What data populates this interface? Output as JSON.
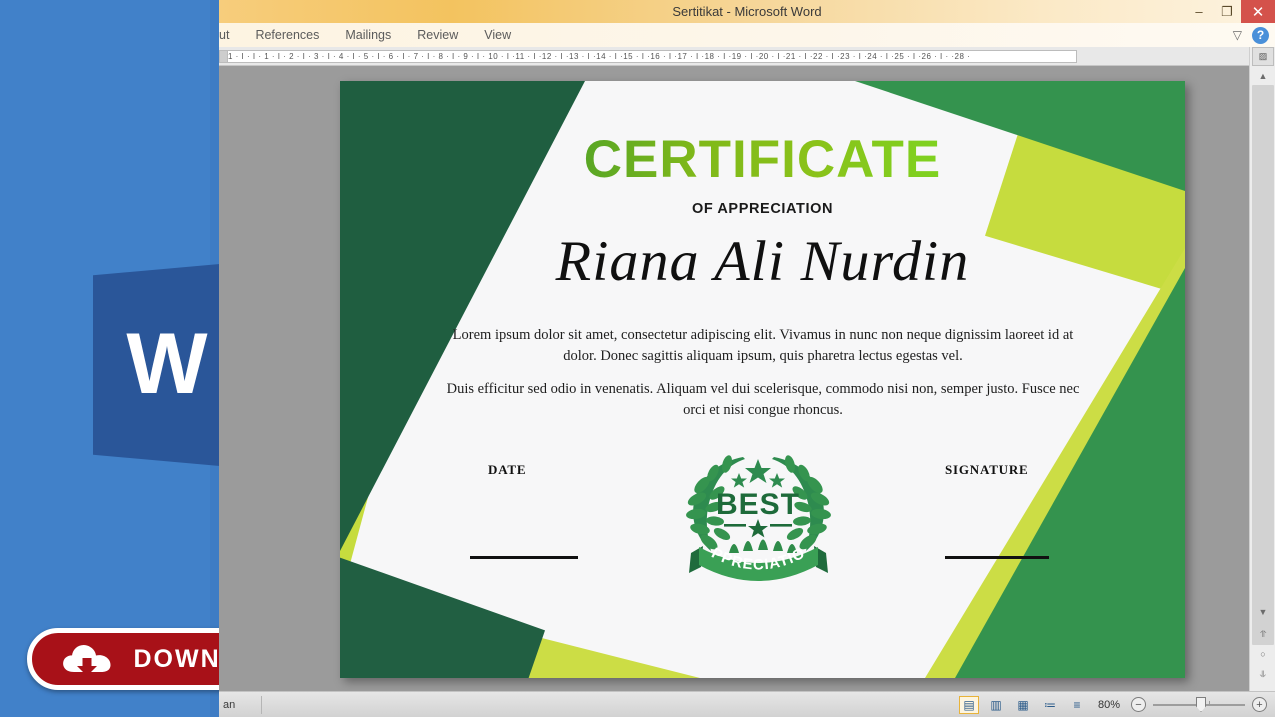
{
  "window": {
    "title": "Sertitikat  -  Microsoft Word",
    "minimize_label": "–",
    "restore_label": "❐",
    "close_label": "✕",
    "collapse_ribbon_label": "▽",
    "help_label": "?"
  },
  "ribbon": {
    "tabs": [
      {
        "label": "ut"
      },
      {
        "label": "References"
      },
      {
        "label": "Mailings"
      },
      {
        "label": "Review"
      },
      {
        "label": "View"
      }
    ]
  },
  "ruler": {
    "marks": "1  ·  I  ·  I  ·  1  ·  I  ·  2  ·  I  ·  3  ·  I  ·  4  ·  I  ·  5  ·  I  ·  6  ·  I  ·  7  ·  I  ·  8  ·  I  ·  9  ·  I  ·  10  ·  I  ·11  ·  I  ·12  ·  I  ·13  ·  I  ·14  ·  I  ·15  ·  I  ·16  ·  I  ·17  ·  I  ·18  ·  I  ·19  ·  I  ·20  ·  I  ·21  ·  I  ·22  ·  I  ·23  ·  I  ·24  ·  I  ·25  ·  I  ·26  ·  I  ·      ·28  ·",
    "corner_icon": "▦"
  },
  "certificate": {
    "title": "CERTIFICATE",
    "subtitle": "OF APPRECIATION",
    "recipient": "Riana Ali Nurdin",
    "paragraph1": "Lorem ipsum dolor sit amet, consectetur adipiscing elit. Vivamus in nunc non neque dignissim laoreet id at dolor. Donec sagittis aliquam ipsum, quis pharetra lectus egestas vel.",
    "paragraph2": "Duis efficitur sed odio in venenatis. Aliquam vel dui scelerisque, commodo nisi non, semper justo. Fusce nec orci et nisi congue rhoncus.",
    "date_label": "DATE",
    "signature_label": "SIGNATURE",
    "badge": {
      "main_text": "BEST",
      "ribbon_text": "APPRECIATION"
    },
    "colors": {
      "dark_green": "#1f5e40",
      "mid_green": "#34934e",
      "lime": "#c6dc3e",
      "paper": "#f7f7f8",
      "title_gradient_start": "#1f7a3a",
      "title_gradient_end": "#6cd427"
    }
  },
  "overlay": {
    "download_label": "DOWNLOAD",
    "download_bg": "#a81118",
    "word_logo_letter": "W",
    "word_logo_color": "#2a5699"
  },
  "statusbar": {
    "left_text": "an",
    "views": [
      {
        "name": "print-layout",
        "glyph": "▤",
        "active": true
      },
      {
        "name": "read-mode",
        "glyph": "▥",
        "active": false
      },
      {
        "name": "web-layout",
        "glyph": "▦",
        "active": false
      },
      {
        "name": "outline",
        "glyph": "≔",
        "active": false
      },
      {
        "name": "draft",
        "glyph": "≡",
        "active": false
      }
    ],
    "zoom_value": "80%",
    "zoom_out_label": "−",
    "zoom_in_label": "+"
  },
  "scrollbar": {
    "up_label": "▲",
    "down_label": "▼",
    "prev_page_label": "⥣",
    "select_object_label": "○",
    "next_page_label": "⥥"
  }
}
